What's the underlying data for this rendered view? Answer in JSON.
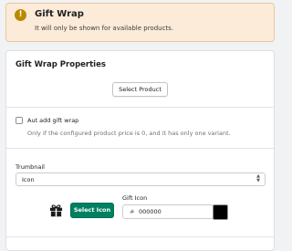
{
  "banner": {
    "title": "Gift Wrap",
    "text": "It will only be shown for available products."
  },
  "card": {
    "title": "Gift Wrap Properties",
    "select_product_label": "Select Product",
    "auto_add_label": "Aut add gift wrap",
    "auto_add_help": "Only if the configured product price is 0, and it has only one variant.",
    "auto_add_checked": false,
    "thumbnail_label": "Trumbnail",
    "thumbnail_value": "Icon",
    "select_icon_label": "Select Icon",
    "gift_icon_label": "Gift Icon",
    "hash": "#",
    "color_value": "000000",
    "swatch_color": "#000000"
  },
  "colors": {
    "banner_bg": "#fbebd8",
    "banner_icon": "#b98900",
    "primary_button": "#008060"
  }
}
